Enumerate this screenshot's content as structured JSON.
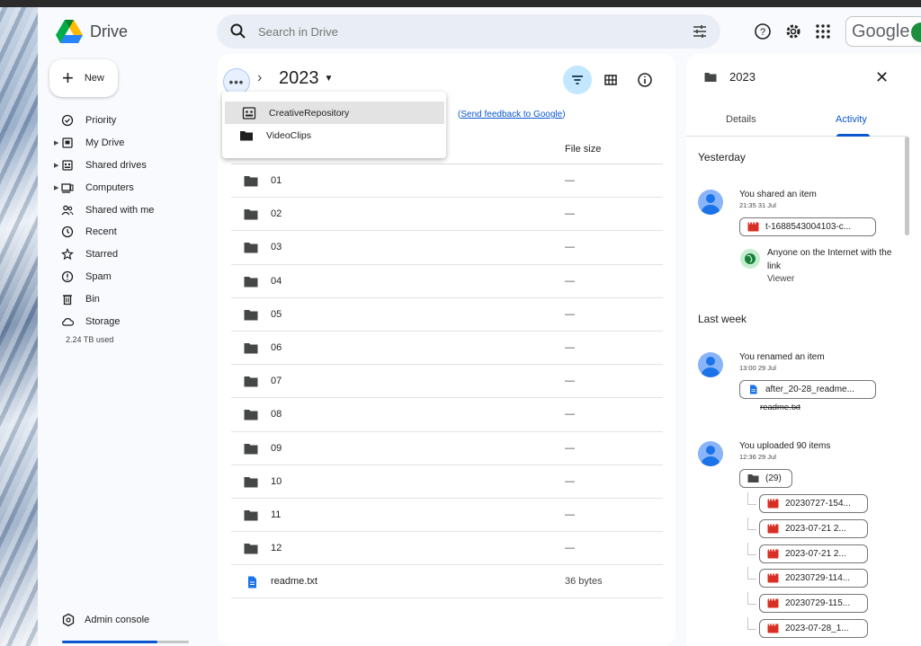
{
  "app": {
    "name": "Drive"
  },
  "search": {
    "placeholder": "Search in Drive"
  },
  "header": {
    "brand": "Google"
  },
  "sidebar": {
    "new_label": "New",
    "items": [
      {
        "label": "Priority",
        "icon": "priority-icon",
        "expandable": false
      },
      {
        "label": "My Drive",
        "icon": "my-drive-icon",
        "expandable": true
      },
      {
        "label": "Shared drives",
        "icon": "shared-drives-icon",
        "expandable": true
      },
      {
        "label": "Computers",
        "icon": "computers-icon",
        "expandable": true
      },
      {
        "label": "Shared with me",
        "icon": "shared-with-me-icon",
        "expandable": false
      },
      {
        "label": "Recent",
        "icon": "recent-icon",
        "expandable": false
      },
      {
        "label": "Starred",
        "icon": "star-icon",
        "expandable": false
      },
      {
        "label": "Spam",
        "icon": "spam-icon",
        "expandable": false
      },
      {
        "label": "Bin",
        "icon": "bin-icon",
        "expandable": false
      },
      {
        "label": "Storage",
        "icon": "cloud-icon",
        "expandable": false
      }
    ],
    "storage_used": "2.24 TB used",
    "storage_fraction": 0.75,
    "admin_label": "Admin console"
  },
  "main": {
    "folder_title": "2023",
    "feedback_label": "Send feedback to Google",
    "column_filesize": "File size",
    "rows": [
      {
        "name": "01",
        "size": "—",
        "type": "folder"
      },
      {
        "name": "02",
        "size": "—",
        "type": "folder"
      },
      {
        "name": "03",
        "size": "—",
        "type": "folder"
      },
      {
        "name": "04",
        "size": "—",
        "type": "folder"
      },
      {
        "name": "05",
        "size": "—",
        "type": "folder"
      },
      {
        "name": "06",
        "size": "—",
        "type": "folder"
      },
      {
        "name": "07",
        "size": "—",
        "type": "folder"
      },
      {
        "name": "08",
        "size": "—",
        "type": "folder"
      },
      {
        "name": "09",
        "size": "—",
        "type": "folder"
      },
      {
        "name": "10",
        "size": "—",
        "type": "folder"
      },
      {
        "name": "11",
        "size": "—",
        "type": "folder"
      },
      {
        "name": "12",
        "size": "—",
        "type": "folder"
      },
      {
        "name": "readme.txt",
        "size": "36 bytes",
        "type": "doc"
      }
    ]
  },
  "dropdown": {
    "items": [
      {
        "label": "CreativeRepository",
        "icon": "shared-drive-icon"
      },
      {
        "label": "VideoClips",
        "icon": "folder-icon"
      }
    ]
  },
  "details": {
    "title": "2023",
    "tab_details": "Details",
    "tab_activity": "Activity",
    "sections": {
      "yesterday": "Yesterday",
      "last_week": "Last week"
    },
    "activity1": {
      "title": "You shared an item",
      "time": "21:35 31 Jul",
      "chip": "t-1688543004103-c...",
      "perm_title": "Anyone on the Internet with the link",
      "perm_role": "Viewer"
    },
    "activity2": {
      "title": "You renamed an item",
      "time": "13:00 29 Jul",
      "chip": "after_20-28_readme...",
      "old_name": "readme.txt"
    },
    "activity3": {
      "title": "You uploaded 90 items",
      "time": "12:36 29 Jul",
      "folder_chip": "(29)",
      "files": [
        "20230727-154...",
        "2023-07-21 2...",
        "2023-07-21 2...",
        "20230729-114...",
        "20230729-115...",
        "2023-07-28_1..."
      ]
    }
  },
  "colors": {
    "accent": "#0b57d0",
    "video": "#d93025",
    "doc": "#1a73e8",
    "selected_filter": "#c2e7ff"
  }
}
